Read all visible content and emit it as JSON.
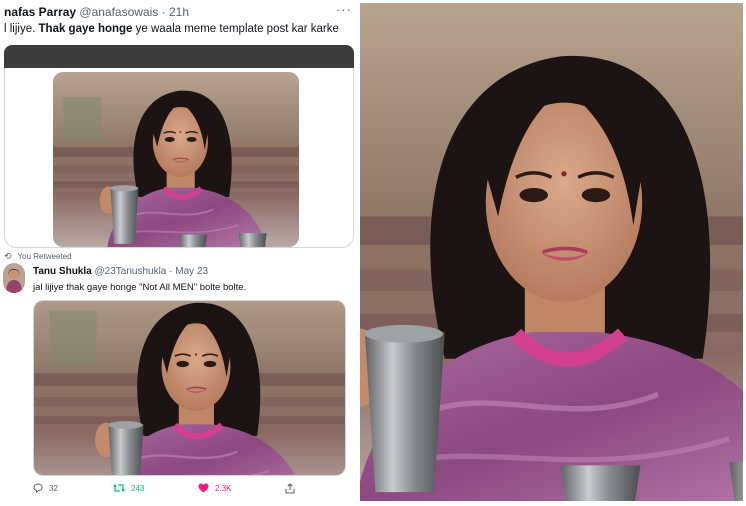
{
  "tweet1": {
    "name": "nafas Parray",
    "handle": "@anafasowais",
    "separator": "·",
    "time": "21h",
    "more": "···",
    "text_prefix": "l lijiye. ",
    "text_bold": "Thak gaye honge",
    "text_suffix": " ye waala meme template post kar karke"
  },
  "tweet2": {
    "retweet_label": "You Retweeted",
    "name": "Tanu Shukla",
    "handle": "@23Tanushukla",
    "separator": "·",
    "time": "May 23",
    "text": "jal lijiye thak gaye honge \"Not All MEN\" bolte bolte.",
    "reply_count": "32",
    "retweet_count": "243",
    "like_count": "2.3K"
  },
  "icons": {
    "retweeted": "retweet-icon",
    "reply": "reply-icon",
    "retweet": "retweet-icon",
    "like": "heart-icon",
    "share": "share-icon",
    "more": "more-icon"
  },
  "colors": {
    "dupatta": "#9b4f86",
    "dupatta_border": "#d2408e",
    "background_wall": "#9c8a78",
    "retweet_green": "#00ba7c",
    "like_pink": "#f91880",
    "secondary_text": "#536471"
  }
}
